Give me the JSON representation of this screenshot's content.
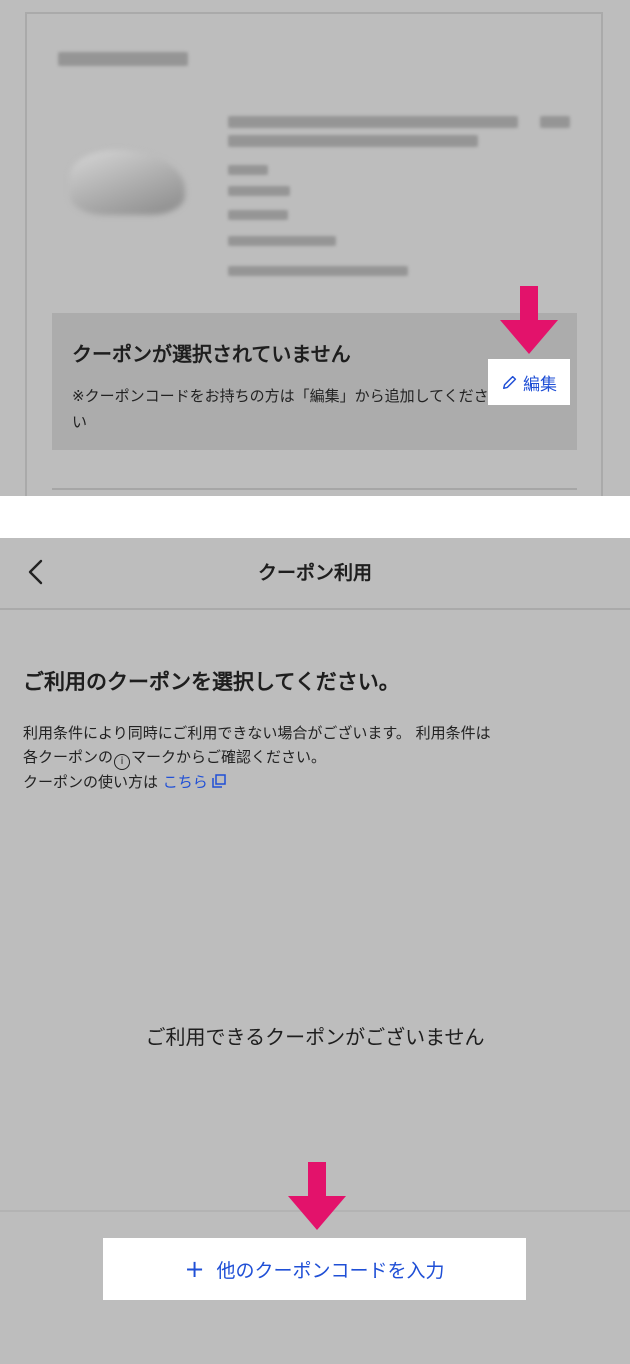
{
  "top": {
    "coupon_box": {
      "title": "クーポンが選択されていません",
      "note": "※クーポンコードをお持ちの方は「編集」から追加してください"
    },
    "edit_button_label": "編集"
  },
  "bottom": {
    "header": {
      "title": "クーポン利用"
    },
    "select_heading": "ご利用のクーポンを選択してください。",
    "info": {
      "line1": "利用条件により同時にご利用できない場合がございます。 利用条件は",
      "line2_prefix": "各クーポンの",
      "line2_icon": "i",
      "line2_suffix": "マークからご確認ください。",
      "line3_prefix": "クーポンの使い方は ",
      "line3_link": "こちら"
    },
    "empty_message": "ご利用できるクーポンがございません",
    "add_button": {
      "plus": "+",
      "label": "他のクーポンコードを入力"
    }
  },
  "colors": {
    "accent_arrow": "#e3126b",
    "link_blue": "#1f4fd6",
    "overlay_gray": "#bdbdbd"
  },
  "icons": [
    "back-chevron-icon",
    "pencil-icon",
    "external-link-icon",
    "info-circle-icon",
    "plus-icon"
  ]
}
